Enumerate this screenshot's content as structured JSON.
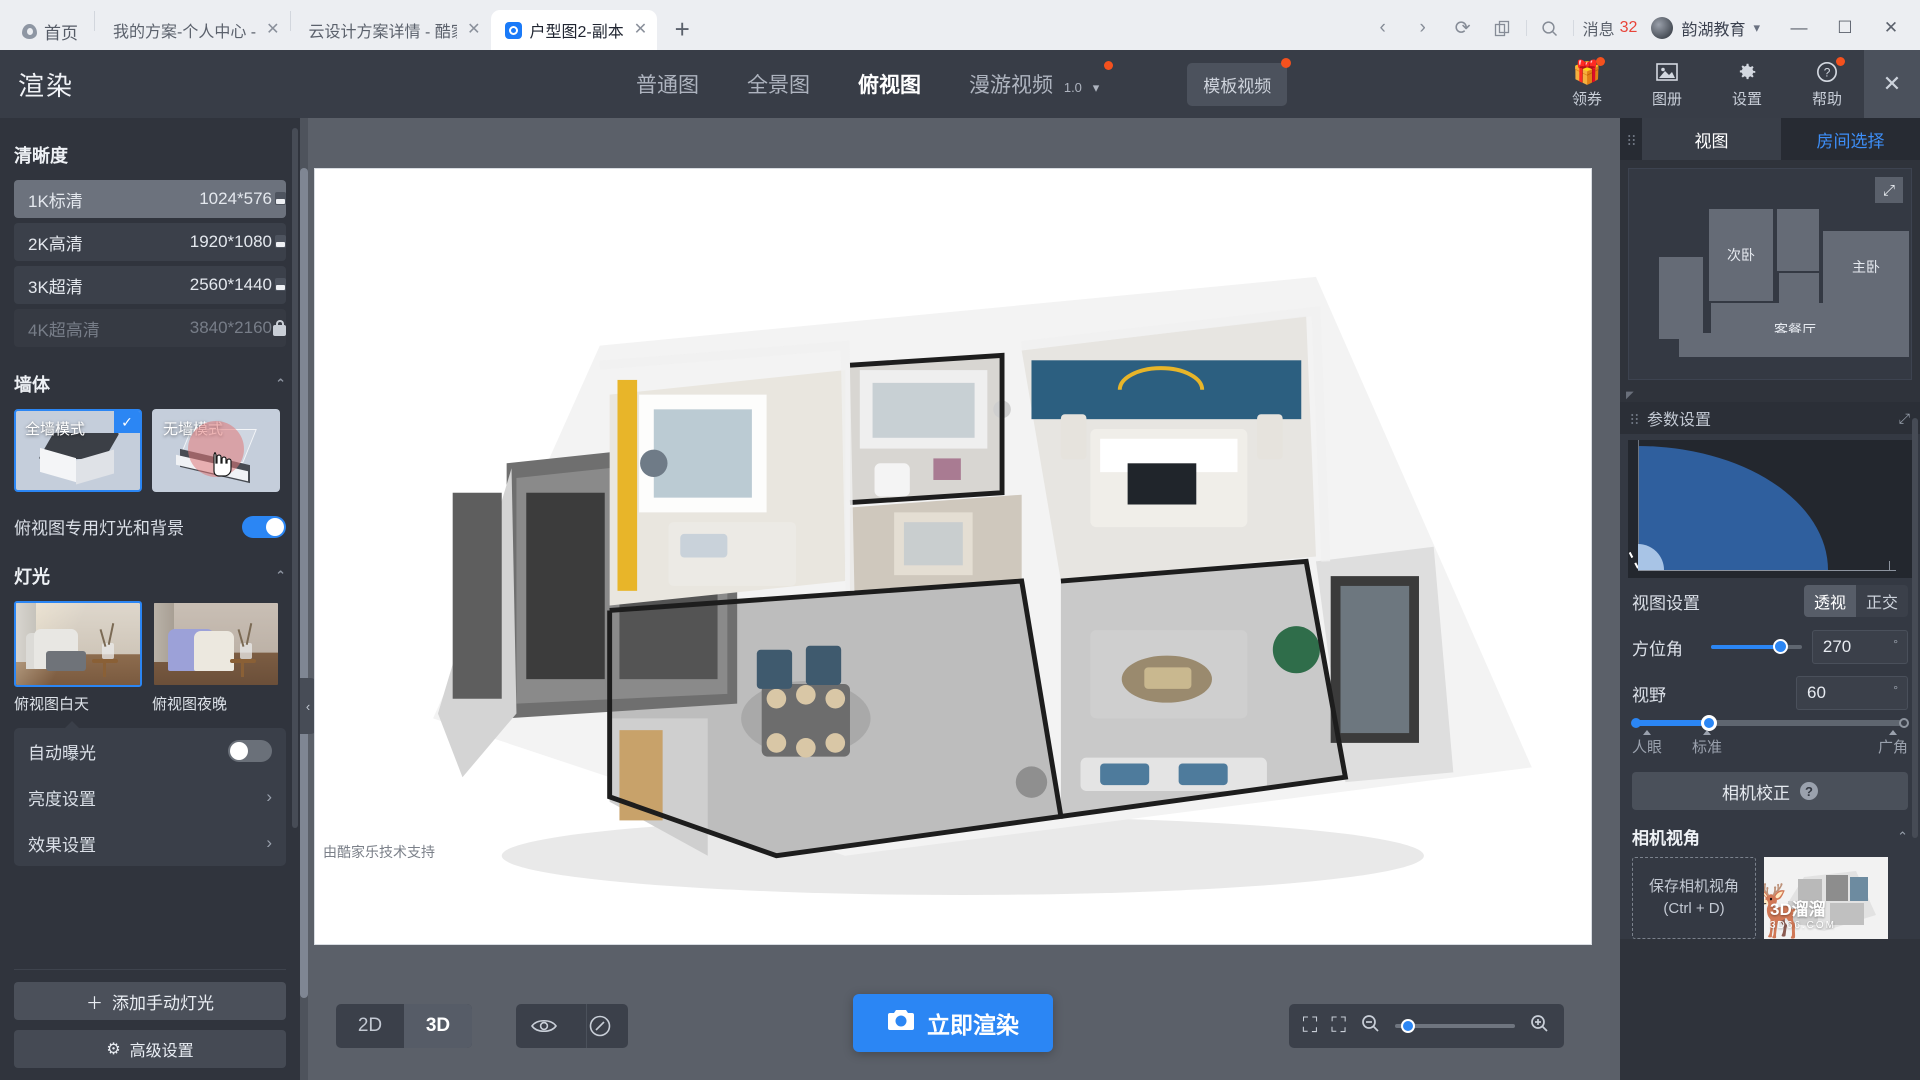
{
  "browser": {
    "home_tab": "首页",
    "tabs": [
      {
        "title": "我的方案-个人中心 -",
        "active": false,
        "closable": true
      },
      {
        "title": "云设计方案详情 - 酷家",
        "active": false,
        "closable": true
      },
      {
        "title": "户型图2-副本",
        "active": true,
        "closable": true
      }
    ],
    "new_tab": "+",
    "nav": {
      "back": "‹",
      "forward": "›",
      "reload": "⟳",
      "copy": "🗐",
      "search": "⌕"
    },
    "message_label": "消息",
    "message_count": "32",
    "user_name": "韵湖教育",
    "window": {
      "minimize": "—",
      "maximize": "☐",
      "close": "✕"
    }
  },
  "header": {
    "brand": "渲染",
    "tabs": [
      {
        "label": "普通图",
        "active": false,
        "badge": false
      },
      {
        "label": "全景图",
        "active": false,
        "badge": false
      },
      {
        "label": "俯视图",
        "active": true,
        "badge": false
      },
      {
        "label": "漫游视频",
        "version": "1.0",
        "active": false,
        "badge": true
      }
    ],
    "template_video": "模板视频",
    "right_icons": [
      {
        "label": "领券",
        "icon": "gift-icon",
        "badge": true
      },
      {
        "label": "图册",
        "icon": "album-icon",
        "badge": false
      },
      {
        "label": "设置",
        "icon": "gear-icon",
        "badge": false
      },
      {
        "label": "帮助",
        "icon": "help-icon",
        "badge": true
      }
    ],
    "close": "✕"
  },
  "left_panel": {
    "clarity": {
      "title": "清晰度",
      "options": [
        {
          "name": "1K标清",
          "size": "1024*576",
          "selected": true,
          "locked": false
        },
        {
          "name": "2K高清",
          "size": "1920*1080",
          "selected": false,
          "locked": false
        },
        {
          "name": "3K超清",
          "size": "2560*1440",
          "selected": false,
          "locked": false
        },
        {
          "name": "4K超高清",
          "size": "3840*2160",
          "selected": false,
          "locked": true
        }
      ]
    },
    "wall": {
      "title": "墙体",
      "options": [
        {
          "label": "全墙模式",
          "selected": true,
          "hovered": false
        },
        {
          "label": "无墙模式",
          "selected": false,
          "hovered": true
        }
      ]
    },
    "topview_toggle": {
      "label": "俯视图专用灯光和背景",
      "on": true
    },
    "lighting": {
      "title": "灯光",
      "options": [
        {
          "label": "俯视图白天",
          "selected": true
        },
        {
          "label": "俯视图夜晚",
          "selected": false
        }
      ]
    },
    "auto_exposure": {
      "label": "自动曝光",
      "on": false
    },
    "brightness_settings": "亮度设置",
    "effect_settings": "效果设置",
    "add_light": "添加手动灯光",
    "advanced_settings": "高级设置"
  },
  "canvas": {
    "watermark": "由酷家乐技术支持",
    "view_modes": [
      {
        "label": "2D",
        "active": false
      },
      {
        "label": "3D",
        "active": true
      }
    ],
    "eye_icon": "◉",
    "compass_icon": "◎",
    "render_button": "立即渲染",
    "camera_icon": "camera-icon",
    "frame_icon": "⛶",
    "focus_icon": "⛶",
    "zoom_out": "−",
    "zoom_in": "+",
    "zoom_value": "10"
  },
  "right_panel": {
    "tabs": [
      {
        "label": "视图",
        "active": true
      },
      {
        "label": "房间选择",
        "active": false
      }
    ],
    "expand_icon": "⤢",
    "rooms": [
      {
        "label": "次卧"
      },
      {
        "label": "主卧"
      },
      {
        "label": "客餐厅"
      }
    ],
    "params": {
      "title": "参数设置",
      "view_setting_label": "视图设置",
      "projection": [
        {
          "label": "透视",
          "active": true
        },
        {
          "label": "正交",
          "active": false
        }
      ],
      "azimuth": {
        "label": "方位角",
        "value": "270",
        "unit": "°"
      },
      "fov": {
        "label": "视野",
        "value": "60",
        "unit": "°"
      },
      "fov_ticks": [
        "人眼",
        "标准",
        "广角"
      ],
      "camera_calibration": "相机校正",
      "help_mark": "?"
    },
    "camera_views": {
      "title": "相机视角",
      "save_label": "保存相机视角",
      "save_shortcut": "(Ctrl + D)",
      "watermark": "3D溜溜",
      "watermark_sub": "3D66.COM"
    }
  }
}
